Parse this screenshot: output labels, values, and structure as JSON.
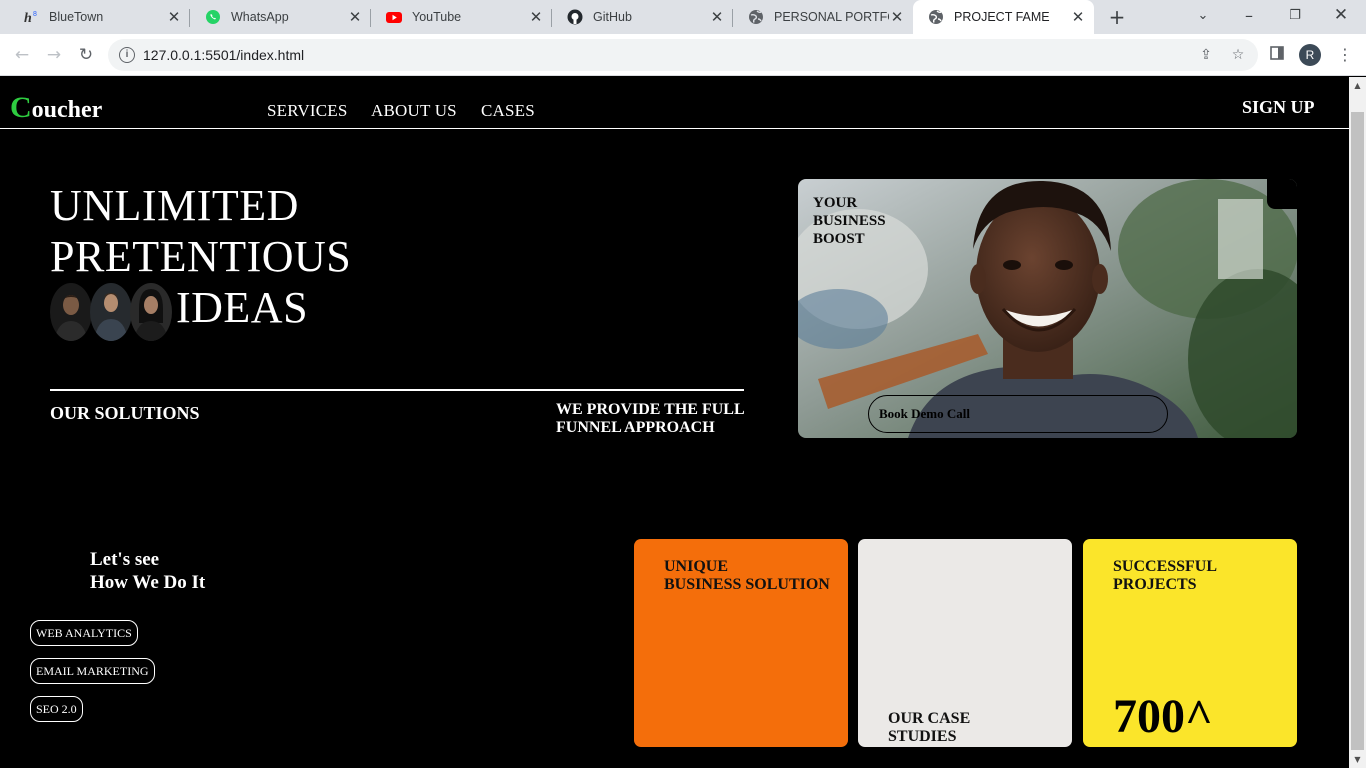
{
  "browser": {
    "tabs": [
      {
        "title": "BlueTown",
        "icon": "hashnode-icon"
      },
      {
        "title": "WhatsApp",
        "icon": "whatsapp-icon"
      },
      {
        "title": "YouTube",
        "icon": "youtube-icon"
      },
      {
        "title": "GitHub",
        "icon": "github-icon"
      },
      {
        "title": "PERSONAL PORTFOLIO",
        "icon": "globe-icon"
      },
      {
        "title": "PROJECT FAME",
        "icon": "globe-icon",
        "active": true
      }
    ],
    "url": "127.0.0.1:5501/index.html",
    "profile_initial": "R"
  },
  "nav": {
    "logo_first": "C",
    "logo_rest": "oucher",
    "links": [
      "SERVICES",
      "ABOUT US",
      "CASES"
    ],
    "signup": "SIGN UP"
  },
  "hero": {
    "line1": "UNLIMITED",
    "line2": "PRETENTIOUS",
    "line3": "IDEAS",
    "solutions": "OUR SOLUTIONS",
    "funnel_line1": "WE PROVIDE THE FULL",
    "funnel_line2": "FUNNEL APPROACH",
    "image_text_1": "YOUR",
    "image_text_2": "BUSINESS",
    "image_text_3": "BOOST",
    "demo_button": "Book Demo Call"
  },
  "howwedo": {
    "line1": "Let's see",
    "line2": "How We Do It",
    "tags": [
      "WEB ANALYTICS",
      "EMAIL MARKETING",
      "SEO 2.0"
    ]
  },
  "cards": [
    {
      "line1": "UNIQUE",
      "line2": "BUSINESS SOLUTION",
      "color": "#f46e0b"
    },
    {
      "line1": "OUR CASE",
      "line2": "STUDIES",
      "color": "#ebe9e7"
    },
    {
      "line1": "SUCCESSFUL",
      "line2": "PROJECTS",
      "value": "700^",
      "color": "#fbe52a"
    }
  ],
  "colors": {
    "accent_green": "#2ecc40",
    "background": "#000000"
  }
}
